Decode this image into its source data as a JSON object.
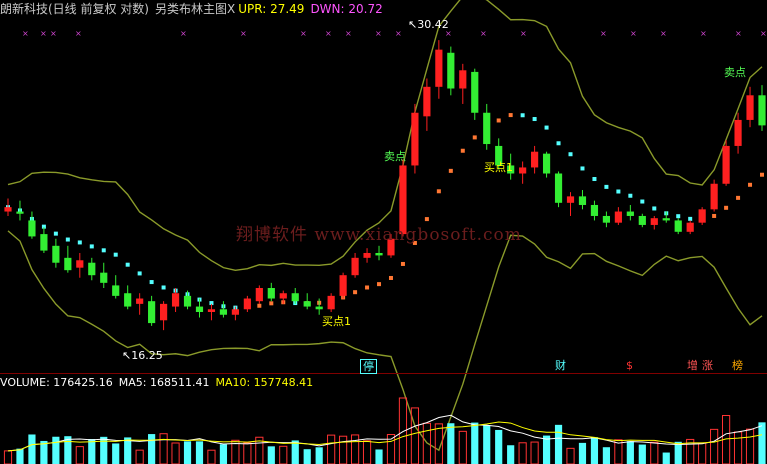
{
  "header": {
    "title": "朗新科技(日线 前复权 对数)",
    "indicator": "另类布林主图X",
    "upr": "UPR: 27.49",
    "dwn": "DWN: 20.72",
    "colors": {
      "title": "#c8c8c8",
      "indicator": "#c8c8c8",
      "upr": "#ffff00",
      "dwn": "#ff55ff"
    }
  },
  "volume_header": {
    "volume": "VOLUME: 176425.16",
    "ma5": "MA5: 168511.41",
    "ma10": "MA10: 157748.41",
    "colors": {
      "volume": "#ffffff",
      "ma5": "#ffffff",
      "ma10": "#ffff00"
    }
  },
  "watermark": "翔博软件 www.xiangbosoft.com",
  "annotations": {
    "high": "30.42",
    "low": "16.25",
    "buy1a": "买点1",
    "buy1b": "买点1",
    "sell1": "卖点",
    "sell2": "卖点"
  },
  "event_badges": [
    {
      "label": "停",
      "color": "#55ffff"
    },
    {
      "label": "财",
      "color": "#55ffff"
    },
    {
      "label": "$",
      "color": "#ff3333"
    },
    {
      "label": "增",
      "color": "#ff5555"
    },
    {
      "label": "涨",
      "color": "#ff5555"
    },
    {
      "label": "榜",
      "color": "#ffaa00"
    }
  ],
  "chart_data": {
    "type": "candlestick",
    "price_scale": "log",
    "candles": [
      {
        "o": 21.0,
        "h": 21.6,
        "l": 20.8,
        "c": 21.2
      },
      {
        "o": 21.0,
        "h": 21.5,
        "l": 20.6,
        "c": 20.9
      },
      {
        "o": 20.6,
        "h": 21.0,
        "l": 19.8,
        "c": 19.9
      },
      {
        "o": 20.0,
        "h": 20.3,
        "l": 19.2,
        "c": 19.3
      },
      {
        "o": 19.5,
        "h": 19.8,
        "l": 18.6,
        "c": 18.8
      },
      {
        "o": 19.0,
        "h": 19.5,
        "l": 18.4,
        "c": 18.5
      },
      {
        "o": 18.6,
        "h": 19.2,
        "l": 18.2,
        "c": 18.9
      },
      {
        "o": 18.8,
        "h": 19.0,
        "l": 18.1,
        "c": 18.3
      },
      {
        "o": 18.4,
        "h": 18.8,
        "l": 17.8,
        "c": 18.0
      },
      {
        "o": 17.9,
        "h": 18.3,
        "l": 17.4,
        "c": 17.5
      },
      {
        "o": 17.6,
        "h": 17.9,
        "l": 17.0,
        "c": 17.1
      },
      {
        "o": 17.2,
        "h": 17.6,
        "l": 16.8,
        "c": 17.4
      },
      {
        "o": 17.3,
        "h": 17.5,
        "l": 16.4,
        "c": 16.5
      },
      {
        "o": 16.6,
        "h": 17.3,
        "l": 16.25,
        "c": 17.2
      },
      {
        "o": 17.1,
        "h": 17.8,
        "l": 16.9,
        "c": 17.6
      },
      {
        "o": 17.5,
        "h": 17.7,
        "l": 17.0,
        "c": 17.1
      },
      {
        "o": 17.1,
        "h": 17.4,
        "l": 16.7,
        "c": 16.9
      },
      {
        "o": 16.9,
        "h": 17.2,
        "l": 16.6,
        "c": 17.0
      },
      {
        "o": 17.0,
        "h": 17.3,
        "l": 16.7,
        "c": 16.8
      },
      {
        "o": 16.8,
        "h": 17.1,
        "l": 16.6,
        "c": 17.0
      },
      {
        "o": 17.0,
        "h": 17.5,
        "l": 16.9,
        "c": 17.4
      },
      {
        "o": 17.3,
        "h": 17.9,
        "l": 17.2,
        "c": 17.8
      },
      {
        "o": 17.8,
        "h": 18.0,
        "l": 17.3,
        "c": 17.4
      },
      {
        "o": 17.4,
        "h": 17.7,
        "l": 17.2,
        "c": 17.6
      },
      {
        "o": 17.6,
        "h": 17.8,
        "l": 17.2,
        "c": 17.3
      },
      {
        "o": 17.3,
        "h": 17.6,
        "l": 17.0,
        "c": 17.1
      },
      {
        "o": 17.1,
        "h": 17.4,
        "l": 16.8,
        "c": 17.0
      },
      {
        "o": 17.0,
        "h": 17.6,
        "l": 16.9,
        "c": 17.5
      },
      {
        "o": 17.5,
        "h": 18.4,
        "l": 17.4,
        "c": 18.3
      },
      {
        "o": 18.3,
        "h": 19.2,
        "l": 18.2,
        "c": 19.0
      },
      {
        "o": 19.0,
        "h": 19.4,
        "l": 18.8,
        "c": 19.2
      },
      {
        "o": 19.2,
        "h": 19.5,
        "l": 18.9,
        "c": 19.1
      },
      {
        "o": 19.1,
        "h": 20.0,
        "l": 19.0,
        "c": 19.8
      },
      {
        "o": 20.0,
        "h": 23.5,
        "l": 19.9,
        "c": 23.2
      },
      {
        "o": 23.2,
        "h": 26.5,
        "l": 22.8,
        "c": 26.0
      },
      {
        "o": 25.8,
        "h": 28.0,
        "l": 25.0,
        "c": 27.5
      },
      {
        "o": 27.5,
        "h": 30.42,
        "l": 26.8,
        "c": 29.8
      },
      {
        "o": 29.6,
        "h": 30.0,
        "l": 27.0,
        "c": 27.4
      },
      {
        "o": 27.4,
        "h": 28.9,
        "l": 26.5,
        "c": 28.5
      },
      {
        "o": 28.4,
        "h": 28.6,
        "l": 25.6,
        "c": 26.0
      },
      {
        "o": 26.0,
        "h": 26.5,
        "l": 24.0,
        "c": 24.3
      },
      {
        "o": 24.2,
        "h": 24.6,
        "l": 23.0,
        "c": 23.2
      },
      {
        "o": 23.2,
        "h": 23.8,
        "l": 22.5,
        "c": 22.8
      },
      {
        "o": 22.8,
        "h": 23.4,
        "l": 22.3,
        "c": 23.1
      },
      {
        "o": 23.1,
        "h": 24.2,
        "l": 22.8,
        "c": 23.9
      },
      {
        "o": 23.8,
        "h": 23.9,
        "l": 22.6,
        "c": 22.8
      },
      {
        "o": 22.8,
        "h": 22.9,
        "l": 21.2,
        "c": 21.4
      },
      {
        "o": 21.4,
        "h": 21.9,
        "l": 20.8,
        "c": 21.7
      },
      {
        "o": 21.7,
        "h": 22.0,
        "l": 21.1,
        "c": 21.3
      },
      {
        "o": 21.3,
        "h": 21.5,
        "l": 20.6,
        "c": 20.8
      },
      {
        "o": 20.8,
        "h": 21.0,
        "l": 20.3,
        "c": 20.5
      },
      {
        "o": 20.5,
        "h": 21.2,
        "l": 20.4,
        "c": 21.0
      },
      {
        "o": 21.0,
        "h": 21.3,
        "l": 20.6,
        "c": 20.8
      },
      {
        "o": 20.8,
        "h": 20.9,
        "l": 20.3,
        "c": 20.4
      },
      {
        "o": 20.4,
        "h": 20.8,
        "l": 20.2,
        "c": 20.7
      },
      {
        "o": 20.7,
        "h": 21.0,
        "l": 20.5,
        "c": 20.6
      },
      {
        "o": 20.6,
        "h": 20.7,
        "l": 20.0,
        "c": 20.1
      },
      {
        "o": 20.1,
        "h": 20.6,
        "l": 20.0,
        "c": 20.5
      },
      {
        "o": 20.5,
        "h": 21.2,
        "l": 20.4,
        "c": 21.1
      },
      {
        "o": 21.1,
        "h": 22.5,
        "l": 21.0,
        "c": 22.3
      },
      {
        "o": 22.3,
        "h": 24.5,
        "l": 22.2,
        "c": 24.2
      },
      {
        "o": 24.2,
        "h": 26.0,
        "l": 23.8,
        "c": 25.6
      },
      {
        "o": 25.6,
        "h": 27.5,
        "l": 25.2,
        "c": 27.0
      },
      {
        "o": 27.0,
        "h": 27.6,
        "l": 25.0,
        "c": 25.3
      }
    ]
  }
}
